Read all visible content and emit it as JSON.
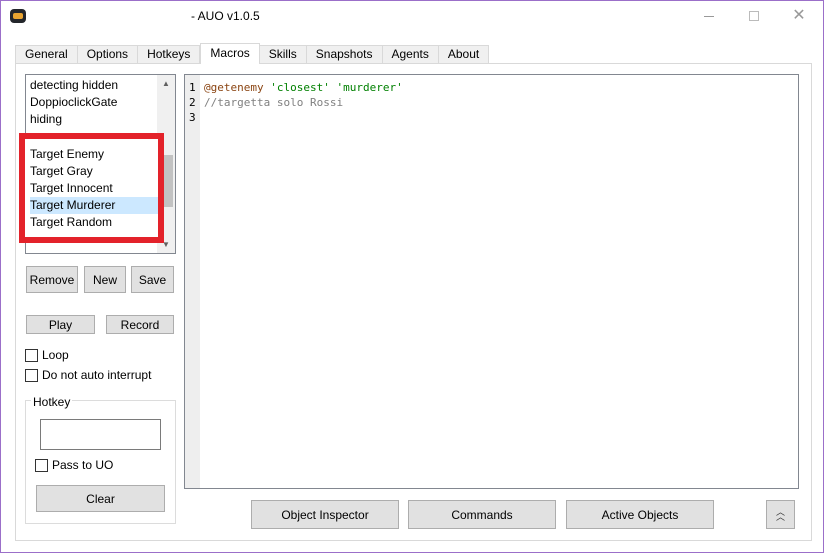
{
  "window": {
    "title": "- AUO v1.0.5"
  },
  "tabs": [
    {
      "label": "General"
    },
    {
      "label": "Options"
    },
    {
      "label": "Hotkeys"
    },
    {
      "label": "Macros"
    },
    {
      "label": "Skills"
    },
    {
      "label": "Snapshots"
    },
    {
      "label": "Agents"
    },
    {
      "label": "About"
    }
  ],
  "active_tab": "Macros",
  "macro_list": {
    "items": [
      {
        "label": "detecting hidden"
      },
      {
        "label": "DoppioclickGate"
      },
      {
        "label": "hiding"
      },
      {
        "label": "Target Enemy"
      },
      {
        "label": "Target Gray"
      },
      {
        "label": "Target Innocent"
      },
      {
        "label": "Target Murderer"
      },
      {
        "label": "Target Random"
      }
    ],
    "selected": "Target Murderer"
  },
  "buttons": {
    "remove": "Remove",
    "new": "New",
    "save": "Save",
    "play": "Play",
    "record": "Record",
    "clear": "Clear",
    "object_inspector": "Object Inspector",
    "commands": "Commands",
    "active_objects": "Active Objects"
  },
  "options": {
    "loop": "Loop",
    "do_not_auto_interrupt": "Do not auto interrupt"
  },
  "hotkey": {
    "legend": "Hotkey",
    "value": "",
    "pass_to_uo": "Pass to UO"
  },
  "editor": {
    "line_numbers": [
      "1",
      "2",
      "3"
    ],
    "line1": {
      "command": "@getenemy",
      "arg1": "'closest'",
      "arg2": "'murderer'"
    },
    "line2": "//targetta solo Rossi",
    "line3": ""
  },
  "colors": {
    "highlight_box": "#e3222a",
    "selection": "#cce8ff",
    "keyword": "#8b4513",
    "string": "#008000",
    "comment": "#808080"
  }
}
